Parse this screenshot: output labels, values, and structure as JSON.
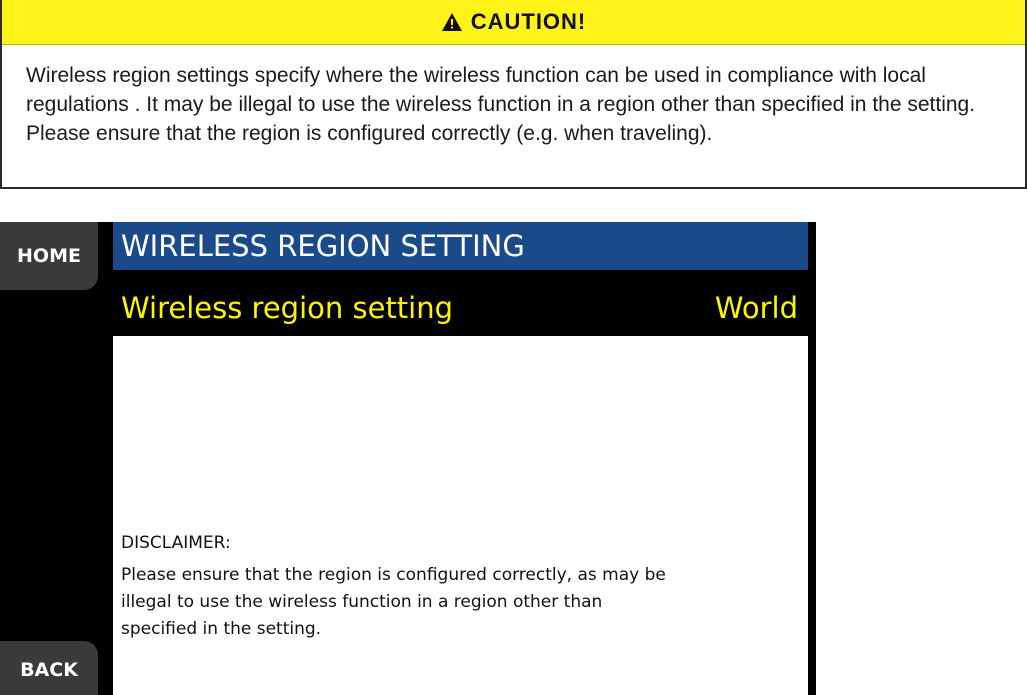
{
  "caution": {
    "title": "CAUTION!",
    "icon": "warning-triangle-icon",
    "header_color": "#fff31a",
    "body": "Wireless region settings specify where the wireless function can be used in compliance with local regulations . It may be illegal to use the wireless function in a region other than specified in the setting. Please ensure that the region is configured correctly (e.g. when traveling)."
  },
  "screen": {
    "home_label": "HOME",
    "back_label": "BACK",
    "title": "WIRELESS REGION SETTING",
    "title_color": "#1a4a8a",
    "setting": {
      "label": "Wireless region setting",
      "value": "World",
      "text_color": "#fff400"
    },
    "disclaimer": {
      "title": "DISCLAIMER:",
      "text": "Please ensure that the region is configured correctly, as  may be illegal to use the wireless function in a region other than specified in the setting."
    }
  }
}
